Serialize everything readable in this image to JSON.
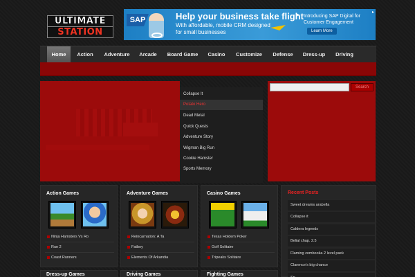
{
  "logo": {
    "line1": "ULTIMATE",
    "line2": "STATION"
  },
  "ad": {
    "brand": "SAP",
    "headline": "Help your business take flight",
    "subline": "With affordable, mobile CRM designed for small businesses",
    "right_text": "Introducing SAP Digital for Customer Engagement",
    "cta": "Learn More"
  },
  "nav": {
    "items": [
      {
        "label": "Home",
        "active": true
      },
      {
        "label": "Action"
      },
      {
        "label": "Adventure"
      },
      {
        "label": "Arcade"
      },
      {
        "label": "Board Game"
      },
      {
        "label": "Casino"
      },
      {
        "label": "Customize"
      },
      {
        "label": "Defense"
      },
      {
        "label": "Dress-up"
      },
      {
        "label": "Driving"
      }
    ]
  },
  "slider": {
    "items": [
      {
        "label": "Collapse It"
      },
      {
        "label": "Potato Hero",
        "active": true
      },
      {
        "label": "Dead Metal"
      },
      {
        "label": "Quick Quests"
      },
      {
        "label": "Adventure Story"
      },
      {
        "label": "Wigman Big Run"
      },
      {
        "label": "Cookie Hamster"
      },
      {
        "label": "Sports Memory"
      }
    ]
  },
  "search": {
    "placeholder": "",
    "button_label": "Search"
  },
  "categories": [
    {
      "title": "Action Games",
      "thumbs": [
        "ninja-hamsters-thumb",
        "run-thumb"
      ],
      "games": [
        "Ninja Hamsters Vs Ro",
        "Run 2",
        "Coast Runners"
      ]
    },
    {
      "title": "Adventure Games",
      "thumbs": [
        "reincarnation-thumb",
        "fatboy-thumb"
      ],
      "games": [
        "Reincarnation: A Ta",
        "Fatboy",
        "Elements Of Arkandia"
      ]
    },
    {
      "title": "Casino Games",
      "thumbs": [
        "solitaire-thumb",
        "tripeaks-thumb"
      ],
      "games": [
        "Texas Holdem Poker",
        "Golf Solitaire",
        "Tripeaks Solitaire"
      ]
    }
  ],
  "bottom_titles": [
    "Dress-up Games",
    "Driving Games",
    "Fighting Games"
  ],
  "recent_posts": {
    "title": "Recent Posts",
    "items": [
      "Sweet dreams arabella",
      "Collapse it",
      "Caldera legends",
      "Belial chap. 2.5",
      "Flaming zombooka 2 level pack",
      "Clarence’s big chance",
      "Sp"
    ]
  },
  "colors": {
    "accent": "#9c0b0b",
    "title_red": "#e22222",
    "background": "#1b1b1b"
  }
}
